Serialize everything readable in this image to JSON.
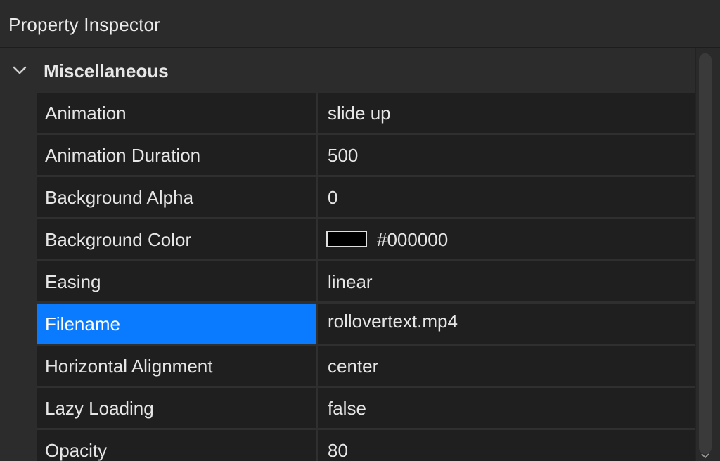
{
  "window": {
    "title": "Property Inspector"
  },
  "section": {
    "title": "Miscellaneous",
    "expanded": true,
    "icon": "chevron-down-icon"
  },
  "properties": [
    {
      "name": "Animation",
      "value": "slide up"
    },
    {
      "name": "Animation Duration",
      "value": "500"
    },
    {
      "name": "Background Alpha",
      "value": "0"
    },
    {
      "name": "Background Color",
      "value": "#000000",
      "swatch_color": "#000000"
    },
    {
      "name": "Easing",
      "value": "linear"
    },
    {
      "name": "Filename",
      "value": "rollovertext.mp4",
      "selected": true,
      "browse_label": "..."
    },
    {
      "name": "Horizontal Alignment",
      "value": "center"
    },
    {
      "name": "Lazy Loading",
      "value": "false"
    },
    {
      "name": "Opacity",
      "value": "80"
    }
  ],
  "colors": {
    "selection": "#0a7aff",
    "background": "#1f1f1f",
    "header": "#2c2c2c"
  }
}
